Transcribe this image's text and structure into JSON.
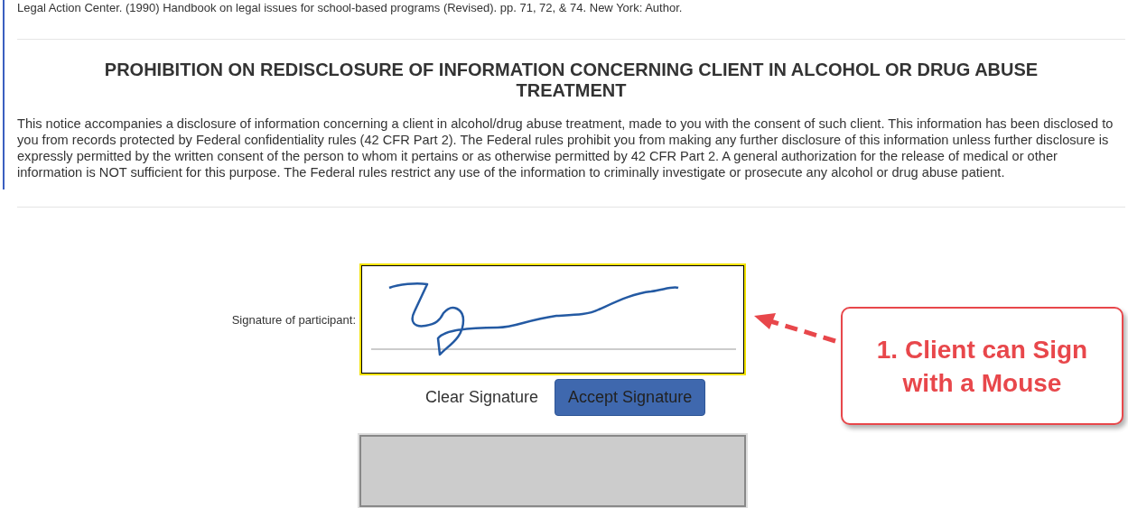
{
  "reference": "Legal Action Center. (1990) Handbook on legal issues for school-based programs (Revised). pp. 71, 72, & 74. New York: Author.",
  "notice": {
    "title": "PROHIBITION ON REDISCLOSURE OF INFORMATION CONCERNING CLIENT IN ALCOHOL OR DRUG ABUSE TREATMENT",
    "body": "This notice accompanies a disclosure of information concerning a client in alcohol/drug abuse treatment, made to you with the consent of such client. This information has been disclosed to you from records protected by Federal confidentiality rules (42 CFR Part 2). The Federal rules prohibit you from making any further disclosure of this information unless further disclosure is expressly permitted by the written consent of the person to whom it pertains or as otherwise permitted by 42 CFR Part 2. A general authorization for the release of medical or other information is NOT sufficient for this purpose. The Federal rules restrict any use of the information to criminally investigate or prosecute any alcohol or drug abuse patient."
  },
  "signature": {
    "label": "Signature of participant:",
    "signed": true,
    "buttons": [
      {
        "kind": "link",
        "label": "Clear Signature"
      },
      {
        "kind": "primary",
        "label": "Accept Signature"
      }
    ]
  },
  "callout": {
    "text": "1. Client can Sign with a Mouse"
  }
}
